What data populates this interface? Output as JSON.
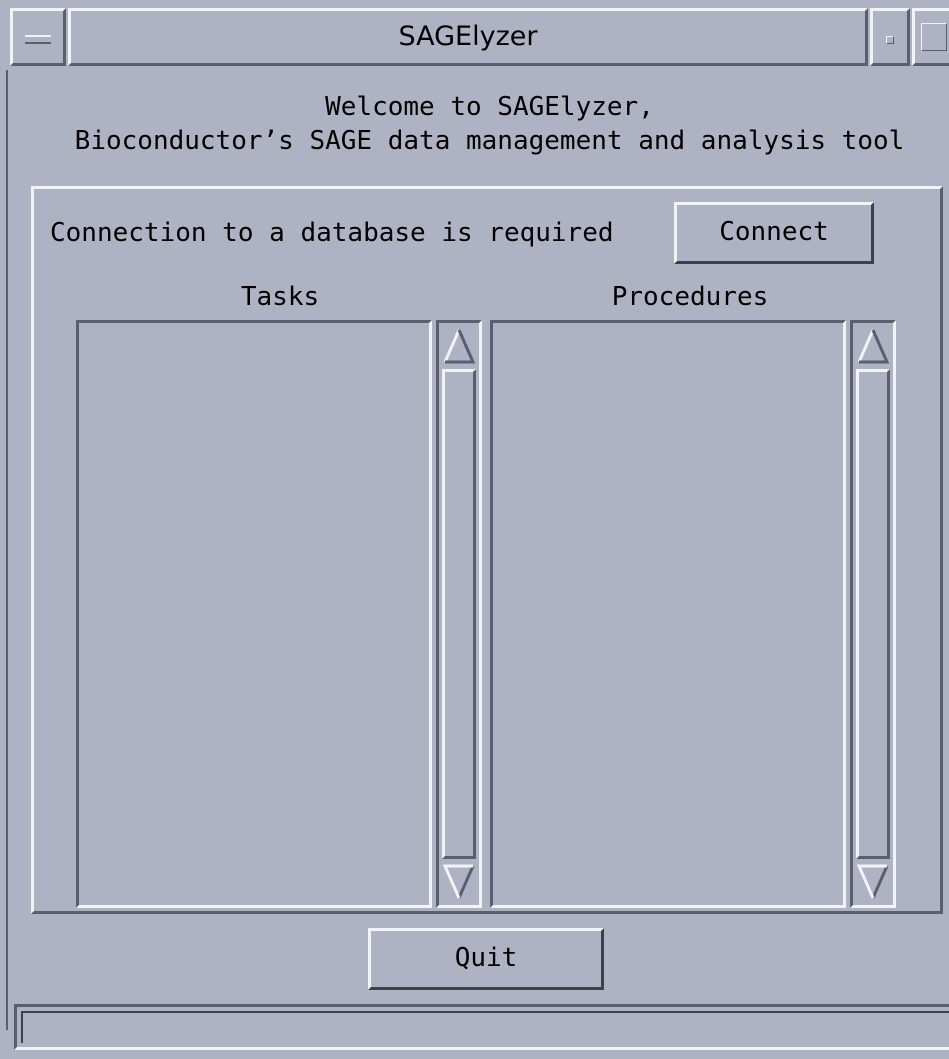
{
  "window": {
    "title": "SAGElyzer"
  },
  "welcome": {
    "text": "Welcome to SAGElyzer,\nBioconductor’s SAGE data management and analysis tool"
  },
  "connection": {
    "label": "Connection to a database is required",
    "connect_label": "Connect"
  },
  "lists": {
    "tasks_label": "Tasks",
    "procedures_label": "Procedures",
    "tasks_items": [],
    "procedures_items": []
  },
  "footer": {
    "quit_label": "Quit",
    "status_text": ""
  },
  "icons": {
    "window_menu": "window-menu-icon",
    "minimize": "minimize-icon",
    "maximize": "maximize-icon",
    "scroll_up": "arrow-up-icon",
    "scroll_down": "arrow-down-icon"
  },
  "colors": {
    "background": "#aeb2c3",
    "highlight": "#f2f3f7",
    "shadow": "#5b5e6e"
  }
}
